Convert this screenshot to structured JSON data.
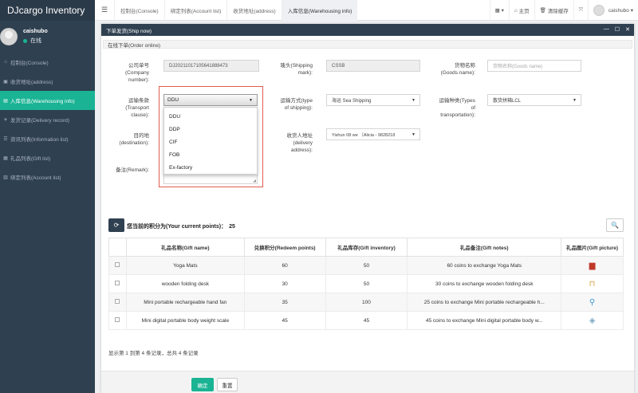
{
  "app": {
    "title": "DJcargo Inventory"
  },
  "user": {
    "name": "caishubo",
    "status": "在线"
  },
  "sidebar": {
    "items": [
      {
        "label": "控制台(Console)",
        "icon": "home-icon"
      },
      {
        "label": "收货地址(address)",
        "icon": "address-icon"
      },
      {
        "label": "入库信息(Warehousing info)",
        "icon": "warehouse-icon"
      },
      {
        "label": "发货记录(Delivery record)",
        "icon": "delivery-icon"
      },
      {
        "label": "资讯列表(Information list)",
        "icon": "info-icon"
      },
      {
        "label": "礼品列表(Gift list)",
        "icon": "gift-icon"
      },
      {
        "label": "绑定列表(Account list)",
        "icon": "account-icon"
      }
    ],
    "active_index": 2
  },
  "tabs": [
    {
      "label": "控制台(Console)"
    },
    {
      "label": "绑定列表(Account list)"
    },
    {
      "label": "收货地址(address)"
    },
    {
      "label": "入库信息(Warehousing info)"
    }
  ],
  "topbar": {
    "home": "主页",
    "clear_cache": "清除缓存",
    "user": "caishubo"
  },
  "dialog": {
    "title": "下单发货(Ship now)",
    "section": "在线下单(Order online)",
    "fields": {
      "company_number": {
        "label1": "公司单号",
        "label2": "(Company",
        "label3": "number):",
        "value": "DJ20211017105641888473"
      },
      "shipping_mark": {
        "label1": "唛头(Shipping",
        "label2": "mark):",
        "value": "CSSB"
      },
      "goods_name": {
        "label1": "货物名称",
        "label2": "(Goods name):",
        "placeholder": "货物名称(Goods name)"
      },
      "transport_clause": {
        "label1": "运输条款",
        "label2": "(Transport",
        "label3": "clause):",
        "value": "DDU"
      },
      "shipping_type": {
        "label1": "运输方式(type",
        "label2": "of shipping):",
        "value": "海运 Sea Shipping"
      },
      "transport_type": {
        "label1": "运输种类(Types",
        "label2": "of",
        "label3": "transportation):",
        "value": "散货拼箱LCL"
      },
      "destination": {
        "label1": "目的地",
        "label2": "(destination):"
      },
      "delivery_address": {
        "label1": "收货人地址",
        "label2": "(delivery",
        "label3": "address):",
        "value": "Yishun 08 we （Alicia - 9828218"
      },
      "remark": {
        "label": "备注(Remark):"
      }
    },
    "clause_options": [
      "DDU",
      "DDP",
      "CIF",
      "FOB",
      "Ex-factory"
    ],
    "points_label": "您当前的积分为(Your current points)：",
    "points_value": "25",
    "table": {
      "headers": [
        "礼品名称(Gift name)",
        "兑换积分(Redeem points)",
        "礼品库存(Gift inventory)",
        "礼品备注(Gift notes)",
        "礼品图片(Gift picture)"
      ],
      "rows": [
        {
          "name": "Yoga Mats",
          "points": "60",
          "inventory": "50",
          "notes": "60 coins to exchange Yoga Mats",
          "icon": "yoga-mat-icon",
          "color": "#c0392b"
        },
        {
          "name": "wooden folding desk",
          "points": "30",
          "inventory": "50",
          "notes": "30 coins to exchange wooden folding desk",
          "icon": "desk-icon",
          "color": "#d9a441"
        },
        {
          "name": "Mini portable rechargeable hand fan",
          "points": "35",
          "inventory": "100",
          "notes": "25 coins to exchange Mini portable rechargeable h...",
          "icon": "fan-icon",
          "color": "#3a9ad9"
        },
        {
          "name": "Mini digital portable body weight scale",
          "points": "45",
          "inventory": "45",
          "notes": "45 coins to exchange Mini digital portable body w...",
          "icon": "scale-icon",
          "color": "#7aa6c2"
        }
      ]
    },
    "footer_info": "显示第 1 到第 4 条记录，总共 4 条记录",
    "ok_label": "确定",
    "reset_label": "重置"
  }
}
